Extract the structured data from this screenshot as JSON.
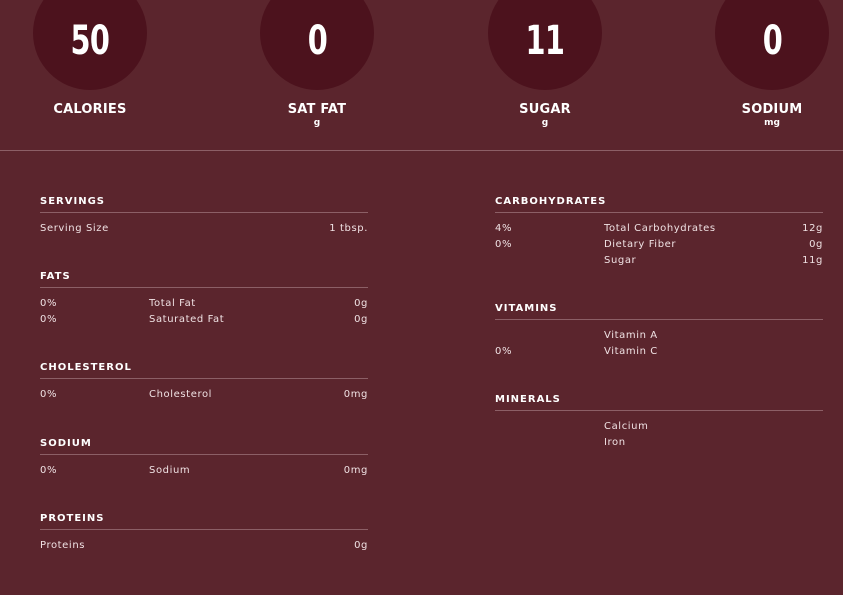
{
  "summary": {
    "calories": {
      "value": "50",
      "label": "CALORIES",
      "unit": ""
    },
    "sat_fat": {
      "value": "0",
      "label": "SAT FAT",
      "unit": "g"
    },
    "sugar": {
      "value": "11",
      "label": "SUGAR",
      "unit": "g"
    },
    "sodium": {
      "value": "0",
      "label": "SODIUM",
      "unit": "mg"
    }
  },
  "servings": {
    "title": "SERVINGS",
    "rows": [
      {
        "name": "Serving Size",
        "value": "1 tbsp."
      }
    ]
  },
  "fats": {
    "title": "FATS",
    "rows": [
      {
        "pct": "0%",
        "name": "Total Fat",
        "value": "0g"
      },
      {
        "pct": "0%",
        "name": "Saturated Fat",
        "value": "0g"
      }
    ]
  },
  "cholesterol": {
    "title": "CHOLESTEROL",
    "rows": [
      {
        "pct": "0%",
        "name": "Cholesterol",
        "value": "0mg"
      }
    ]
  },
  "sodium": {
    "title": "SODIUM",
    "rows": [
      {
        "pct": "0%",
        "name": "Sodium",
        "value": "0mg"
      }
    ]
  },
  "proteins": {
    "title": "PROTEINS",
    "rows": [
      {
        "name": "Proteins",
        "value": "0g"
      }
    ]
  },
  "carbohydrates": {
    "title": "CARBOHYDRATES",
    "rows": [
      {
        "pct": "4%",
        "name": "Total Carbohydrates",
        "value": "12g"
      },
      {
        "pct": "0%",
        "name": "Dietary Fiber",
        "value": "0g"
      },
      {
        "pct": "",
        "name": "Sugar",
        "value": "11g"
      }
    ]
  },
  "vitamins": {
    "title": "VITAMINS",
    "rows": [
      {
        "pct": "",
        "name": "Vitamin A",
        "value": ""
      },
      {
        "pct": "0%",
        "name": "Vitamin C",
        "value": ""
      }
    ]
  },
  "minerals": {
    "title": "MINERALS",
    "rows": [
      {
        "pct": "",
        "name": "Calcium",
        "value": ""
      },
      {
        "pct": "",
        "name": "Iron",
        "value": ""
      }
    ]
  },
  "colors": {
    "background": "#5b252d",
    "circle": "#4c121d",
    "divider": "#8c5f66"
  }
}
